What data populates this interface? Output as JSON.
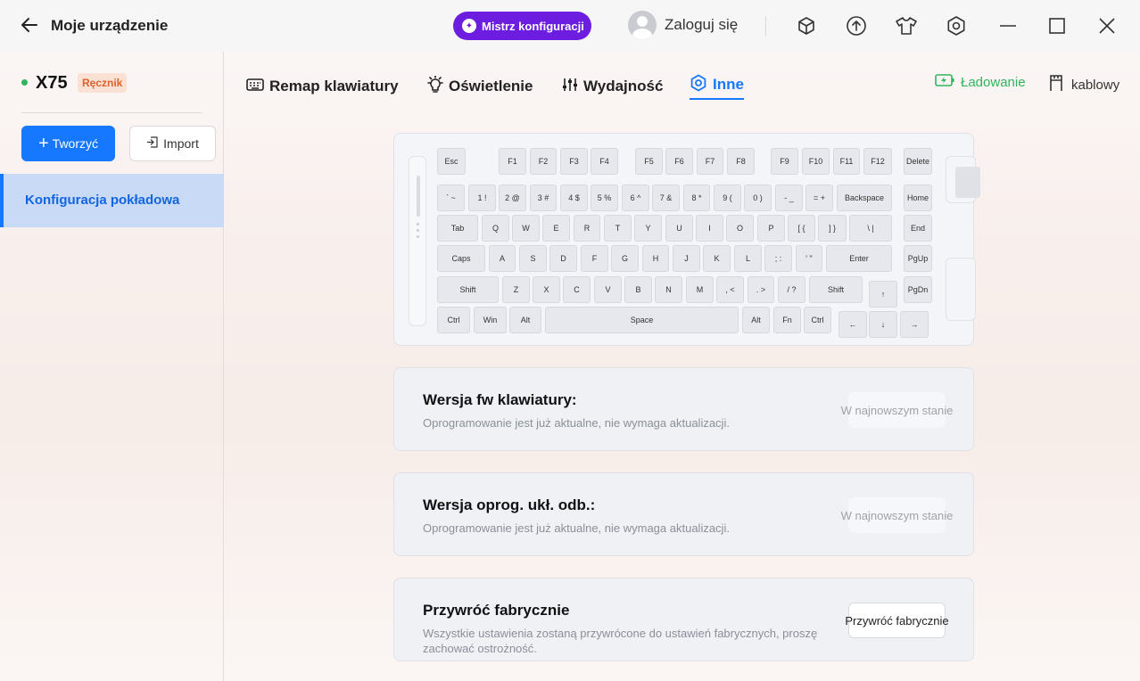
{
  "header": {
    "title": "Moje urządzenie",
    "wizard_label": "Mistrz konfiguracji",
    "login_label": "Zaloguj się",
    "icons": [
      "cube-icon",
      "upload-icon",
      "tshirt-icon",
      "hexagon-settings-icon"
    ],
    "accent": "#6c1de0"
  },
  "sidebar": {
    "device_name": "X75",
    "device_badge": "Ręcznik",
    "create_label": "Tworzyć",
    "import_label": "Import",
    "items": [
      {
        "label": "Konfiguracja pokładowa",
        "active": true
      }
    ],
    "status_dot_color": "#2fb55d"
  },
  "tabs": [
    {
      "label": "Remap klawiatury",
      "icon": "keyboard-icon"
    },
    {
      "label": "Oświetlenie",
      "icon": "bulb-icon"
    },
    {
      "label": "Wydajność",
      "icon": "sliders-icon"
    },
    {
      "label": "Inne",
      "icon": "hexagon-icon",
      "active": true
    }
  ],
  "status": {
    "charging_label": "Ładowanie",
    "connection_label": "kablowy",
    "charging_color": "#2fb55d"
  },
  "keyboard": {
    "rows": [
      [
        "Esc",
        "F1",
        "F2",
        "F3",
        "F4",
        "F5",
        "F6",
        "F7",
        "F8",
        "F9",
        "F10",
        "F11",
        "F12",
        "Delete"
      ],
      [
        "` ~",
        "1 !",
        "2 @",
        "3 #",
        "4 $",
        "5 %",
        "6 ^",
        "7 &",
        "8 *",
        "9 (",
        "0 )",
        "- _",
        "= +",
        "Backspace",
        "Home"
      ],
      [
        "Tab",
        "Q",
        "W",
        "E",
        "R",
        "T",
        "Y",
        "U",
        "I",
        "O",
        "P",
        "[ {",
        "] }",
        "\\ |",
        "End"
      ],
      [
        "Caps",
        "A",
        "S",
        "D",
        "F",
        "G",
        "H",
        "J",
        "K",
        "L",
        "; :",
        "' \"",
        "Enter",
        "PgUp"
      ],
      [
        "Shift",
        "Z",
        "X",
        "C",
        "V",
        "B",
        "N",
        "M",
        ", <",
        ". >",
        "/ ?",
        "Shift",
        "↑",
        "PgDn"
      ],
      [
        "Ctrl",
        "Win",
        "Alt",
        "Space",
        "Alt",
        "Fn",
        "Ctrl",
        "←",
        "↓",
        "→"
      ]
    ]
  },
  "cards": [
    {
      "title": "Wersja fw klawiatury:",
      "desc": "Oprogramowanie jest już aktualne, nie wymaga aktualizacji.",
      "button": "W najnowszym stanie"
    },
    {
      "title": "Wersja oprog. ukł. odb.:",
      "desc": "Oprogramowanie jest już aktualne, nie wymaga aktualizacji.",
      "button": "W najnowszym stanie"
    },
    {
      "title": "Przywróć fabrycznie",
      "desc": "Wszystkie ustawienia zostaną przywrócone do ustawień fabrycznych, proszę zachować ostrożność.",
      "button": "Przywróć fabrycznie"
    }
  ]
}
